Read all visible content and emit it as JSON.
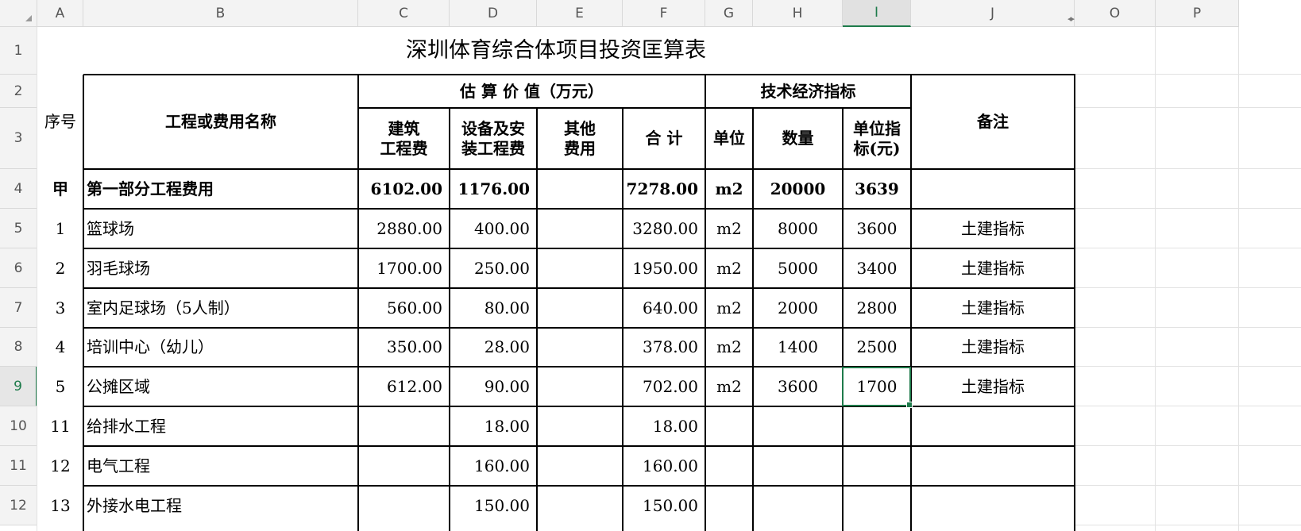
{
  "columns": [
    "A",
    "B",
    "C",
    "D",
    "E",
    "F",
    "G",
    "H",
    "I",
    "J",
    "O",
    "P"
  ],
  "rows": [
    "1",
    "2",
    "3",
    "4",
    "5",
    "6",
    "7",
    "8",
    "9",
    "10",
    "11",
    "12"
  ],
  "active": {
    "column": "I",
    "row": "9"
  },
  "title": "深圳体育综合体项目投资匡算表",
  "headers": {
    "seq": "序号",
    "name": "工程或费用名称",
    "estimate_group": "估 算 价 值（万元）",
    "tech_group": "技术经济指标",
    "remark": "备注",
    "build_cost": "建筑\n工程费",
    "equip_cost": "设备及安\n装工程费",
    "other_cost": "其他\n费用",
    "total": "合 计",
    "unit": "单位",
    "qty": "数量",
    "unit_index": "单位指\n标(元)"
  },
  "data_rows": [
    {
      "seq": "甲",
      "name": "第一部分工程费用",
      "build": "6102.00",
      "equip": "1176.00",
      "other": "",
      "total": "7278.00",
      "unit": "m2",
      "qty": "20000",
      "index": "3639",
      "remark": "",
      "bold": true
    },
    {
      "seq": "1",
      "name": "篮球场",
      "build": "2880.00",
      "equip": "400.00",
      "other": "",
      "total": "3280.00",
      "unit": "m2",
      "qty": "8000",
      "index": "3600",
      "remark": "土建指标",
      "bold": false
    },
    {
      "seq": "2",
      "name": "羽毛球场",
      "build": "1700.00",
      "equip": "250.00",
      "other": "",
      "total": "1950.00",
      "unit": "m2",
      "qty": "5000",
      "index": "3400",
      "remark": "土建指标",
      "bold": false
    },
    {
      "seq": "3",
      "name": "室内足球场（5人制）",
      "build": "560.00",
      "equip": "80.00",
      "other": "",
      "total": "640.00",
      "unit": "m2",
      "qty": "2000",
      "index": "2800",
      "remark": "土建指标",
      "bold": false
    },
    {
      "seq": "4",
      "name": "培训中心（幼儿）",
      "build": "350.00",
      "equip": "28.00",
      "other": "",
      "total": "378.00",
      "unit": "m2",
      "qty": "1400",
      "index": "2500",
      "remark": "土建指标",
      "bold": false
    },
    {
      "seq": "5",
      "name": "公摊区域",
      "build": "612.00",
      "equip": "90.00",
      "other": "",
      "total": "702.00",
      "unit": "m2",
      "qty": "3600",
      "index": "1700",
      "remark": "土建指标",
      "bold": false
    },
    {
      "seq": "11",
      "name": "给排水工程",
      "build": "",
      "equip": "18.00",
      "other": "",
      "total": "18.00",
      "unit": "",
      "qty": "",
      "index": "",
      "remark": "",
      "bold": false
    },
    {
      "seq": "12",
      "name": "电气工程",
      "build": "",
      "equip": "160.00",
      "other": "",
      "total": "160.00",
      "unit": "",
      "qty": "",
      "index": "",
      "remark": "",
      "bold": false
    },
    {
      "seq": "13",
      "name": "外接水电工程",
      "build": "",
      "equip": "150.00",
      "other": "",
      "total": "150.00",
      "unit": "",
      "qty": "",
      "index": "",
      "remark": "",
      "bold": false
    }
  ]
}
